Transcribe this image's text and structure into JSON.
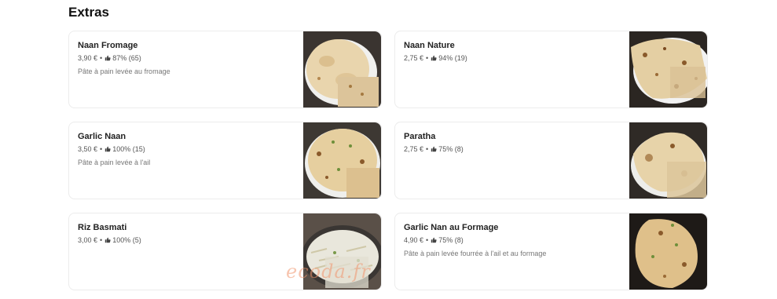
{
  "section": {
    "title": "Extras"
  },
  "items": [
    {
      "name": "Naan Fromage",
      "price": "3,90 €",
      "rating": "87% (65)",
      "description": "Pâte à pain levée au fromage",
      "image_icon": "naan-cheese-photo"
    },
    {
      "name": "Naan Nature",
      "price": "2,75 €",
      "rating": "94% (19)",
      "description": "",
      "image_icon": "naan-plain-photo"
    },
    {
      "name": "Garlic Naan",
      "price": "3,50 €",
      "rating": "100% (15)",
      "description": "Pâte à pain levée à l'ail",
      "image_icon": "garlic-naan-photo"
    },
    {
      "name": "Paratha",
      "price": "2,75 €",
      "rating": "75% (8)",
      "description": "",
      "image_icon": "paratha-photo"
    },
    {
      "name": "Riz Basmati",
      "price": "3,00 €",
      "rating": "100% (5)",
      "description": "",
      "image_icon": "basmati-rice-photo"
    },
    {
      "name": "Garlic Nan au Formage",
      "price": "4,90 €",
      "rating": "75% (8)",
      "description": "Pâte à pain levée fourrée à l'ail et au formage",
      "image_icon": "garlic-cheese-naan-photo"
    }
  ],
  "separator": "•",
  "watermark": "ecoda.fr",
  "colors": {
    "card_border": "#ececec",
    "bread": "#e8d3a8",
    "char": "#8a5a2b",
    "photo_bg": "#2b2622"
  }
}
